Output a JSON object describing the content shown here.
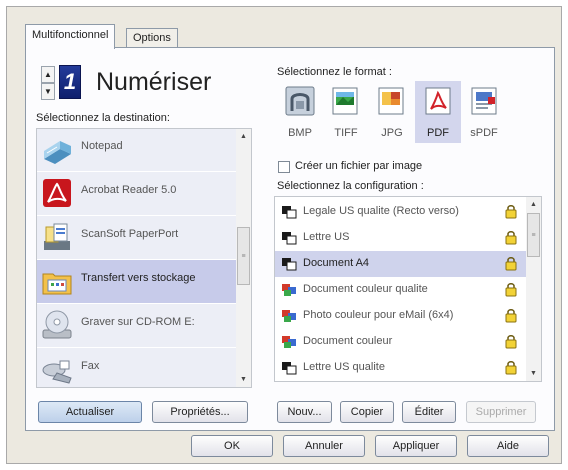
{
  "tabs": [
    {
      "label": "Multifonctionnel"
    },
    {
      "label": "Options"
    }
  ],
  "header": {
    "mode_number": "1",
    "title": "Numériser"
  },
  "destination": {
    "label": "Sélectionnez la destination:",
    "items": [
      {
        "name": "Notepad",
        "icon": "notepad-icon"
      },
      {
        "name": "Acrobat Reader 5.0",
        "icon": "acrobat-icon"
      },
      {
        "name": "ScanSoft PaperPort",
        "icon": "paperport-icon"
      },
      {
        "name": "Transfert vers stockage",
        "icon": "storage-icon",
        "selected": true
      },
      {
        "name": "Graver sur CD-ROM  E:",
        "icon": "cd-burn-icon"
      },
      {
        "name": "Fax",
        "icon": "fax-icon"
      }
    ]
  },
  "format": {
    "label": "Sélectionnez le format :",
    "options": [
      {
        "label": "BMP",
        "icon": "bmp-icon"
      },
      {
        "label": "TIFF",
        "icon": "tiff-icon"
      },
      {
        "label": "JPG",
        "icon": "jpg-icon"
      },
      {
        "label": "PDF",
        "icon": "pdf-icon",
        "selected": true
      },
      {
        "label": "sPDF",
        "icon": "spdf-icon"
      }
    ],
    "per_image_checkbox": {
      "label": "Créer un fichier par image",
      "checked": false
    }
  },
  "configuration": {
    "label": "Sélectionnez la configuration :",
    "items": [
      {
        "name": "Legale US qualite (Recto verso)",
        "mode": "bw"
      },
      {
        "name": "Lettre US",
        "mode": "bw"
      },
      {
        "name": "Document A4",
        "mode": "bw",
        "selected": true
      },
      {
        "name": "Document couleur qualite",
        "mode": "color"
      },
      {
        "name": "Photo couleur pour eMail (6x4)",
        "mode": "color"
      },
      {
        "name": "Document couleur",
        "mode": "color"
      },
      {
        "name": "Lettre US qualite",
        "mode": "bw"
      }
    ]
  },
  "buttons": {
    "refresh": "Actualiser",
    "properties": "Propriétés...",
    "new": "Nouv...",
    "copy": "Copier",
    "edit": "Éditer",
    "delete": "Supprimer",
    "ok": "OK",
    "cancel": "Annuler",
    "apply": "Appliquer",
    "help": "Aide"
  },
  "colors": {
    "selection": "#c7cbea",
    "list_item_bg": "#eceef6",
    "dialog_bg": "#ece9e0",
    "mode_icon": "#1a2d85"
  }
}
